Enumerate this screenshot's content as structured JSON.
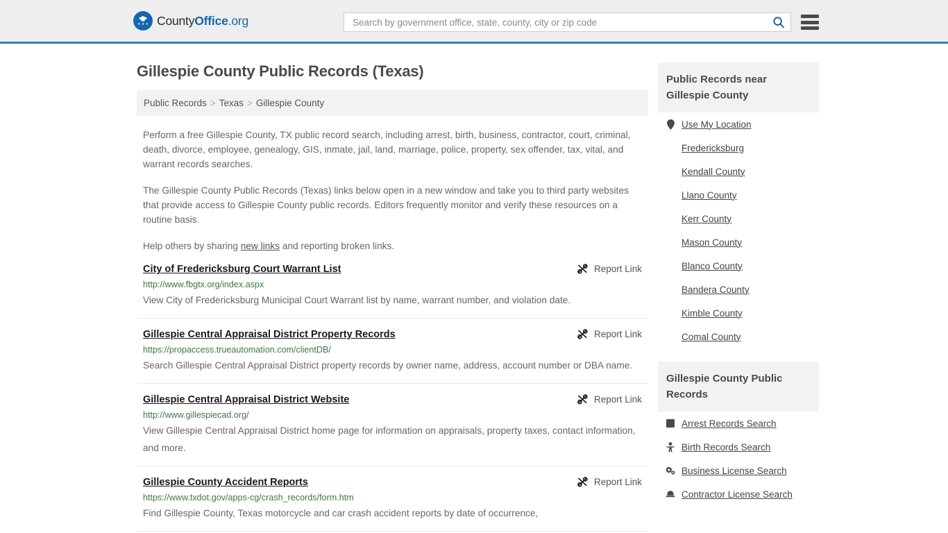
{
  "header": {
    "logo": {
      "icon": "eagle-seal-icon",
      "text_plain": "County",
      "text_bold": "Office",
      "text_suffix": ".org"
    },
    "search": {
      "placeholder": "Search by government office, state, county, city or zip code",
      "value": "",
      "icon": "search-icon"
    },
    "menu_icon": "hamburger-menu-icon",
    "accent_color": "#3c7dad",
    "background_color": "#eeeeee"
  },
  "main": {
    "page_title": "Gillespie County Public Records (Texas)",
    "breadcrumb": {
      "items": [
        "Public Records",
        "Texas",
        "Gillespie County"
      ],
      "separator": ">"
    },
    "intro_paragraph": "Perform a free Gillespie County, TX public record search, including arrest, birth, business, contractor, court, criminal, death, divorce, employee, genealogy, GIS, inmate, jail, land, marriage, police, property, sex offender, tax, vital, and warrant records searches.",
    "second_paragraph": "The Gillespie County Public Records (Texas) links below open in a new window and take you to third party websites that provide access to Gillespie County public records. Editors frequently monitor and verify these resources on a routine basis.",
    "help_prefix": "Help others by sharing ",
    "help_link": "new links",
    "help_suffix": " and reporting broken links.",
    "report_label": "Report Link",
    "report_icon": "broken-link-icon",
    "results": [
      {
        "title": "City of Fredericksburg Court Warrant List",
        "url": "http://www.fbgtx.org/index.aspx",
        "description": "View City of Fredericksburg Municipal Court Warrant list by name, warrant number, and violation date."
      },
      {
        "title": "Gillespie Central Appraisal District Property Records",
        "url": "https://propaccess.trueautomation.com/clientDB/",
        "description": "Search Gillespie Central Appraisal District property records by owner name, address, account number or DBA name."
      },
      {
        "title": "Gillespie Central Appraisal District Website",
        "url": "http://www.gillespiecad.org/",
        "description": "View Gillespie Central Appraisal District home page for information on appraisals, property taxes, contact information, and more."
      },
      {
        "title": "Gillespie County Accident Reports",
        "url": "https://www.txdot.gov/apps-cg/crash_records/form.htm",
        "description": "Find Gillespie County, Texas motorcycle and car crash accident reports by date of occurrence,"
      }
    ]
  },
  "sidebar": {
    "nearby": {
      "heading": "Public Records near Gillespie County",
      "items": [
        {
          "label": "Use My Location",
          "icon": "map-pin-icon"
        },
        {
          "label": "Fredericksburg",
          "icon": ""
        },
        {
          "label": "Kendall County",
          "icon": ""
        },
        {
          "label": "Llano County",
          "icon": ""
        },
        {
          "label": "Kerr County",
          "icon": ""
        },
        {
          "label": "Mason County",
          "icon": ""
        },
        {
          "label": "Blanco County",
          "icon": ""
        },
        {
          "label": "Bandera County",
          "icon": ""
        },
        {
          "label": "Kimble County",
          "icon": ""
        },
        {
          "label": "Comal County",
          "icon": ""
        }
      ]
    },
    "records": {
      "heading": "Gillespie County Public Records",
      "items": [
        {
          "label": "Arrest Records Search",
          "icon": "square-icon"
        },
        {
          "label": "Birth Records Search",
          "icon": "baby-icon"
        },
        {
          "label": "Business License Search",
          "icon": "cogs-icon"
        },
        {
          "label": "Contractor License Search",
          "icon": "hard-hat-icon"
        }
      ]
    }
  }
}
